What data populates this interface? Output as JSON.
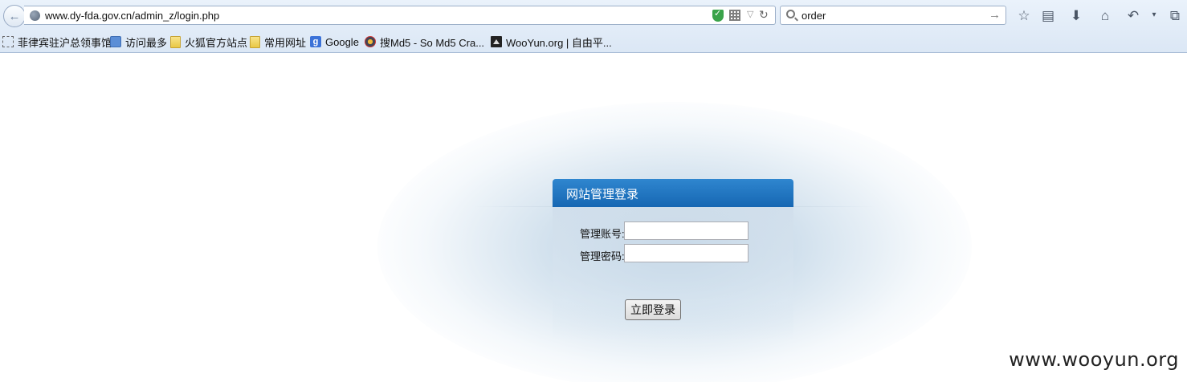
{
  "browser": {
    "url": "www.dy-fda.gov.cn/admin_z/login.php",
    "search_query": "order",
    "toolbar_icons": [
      "star-icon",
      "reading-list-icon",
      "download-icon",
      "home-icon",
      "undo-icon",
      "menu-dropdown-icon",
      "screenshot-icon"
    ],
    "bookmarks": [
      {
        "label": "菲律宾驻沪总领事馆",
        "icon": "dotted-square-icon"
      },
      {
        "label": "访问最多",
        "icon": "page-icon"
      },
      {
        "label": "火狐官方站点",
        "icon": "folder-icon"
      },
      {
        "label": "常用网址",
        "icon": "folder-icon"
      },
      {
        "label": "Google",
        "icon": "google-icon"
      },
      {
        "label": "搜Md5 - So Md5 Cra...",
        "icon": "md5-icon"
      },
      {
        "label": "WooYun.org | 自由平...",
        "icon": "wooyun-icon"
      }
    ]
  },
  "login": {
    "title": "网站管理登录",
    "username_label": "管理账号:",
    "username_value": "",
    "password_label": "管理密码:",
    "password_value": "",
    "submit_label": "立即登录"
  },
  "watermark": "www.wooyun.org",
  "colors": {
    "header_blue": "#1f74c0",
    "chrome_bg": "#dfe9f5"
  }
}
